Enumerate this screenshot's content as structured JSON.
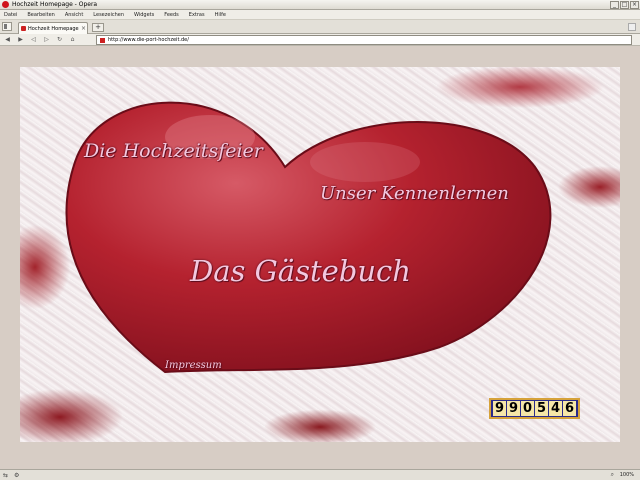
{
  "window": {
    "title": "Hochzeit Homepage - Opera"
  },
  "menu": [
    "Datei",
    "Bearbeiten",
    "Ansicht",
    "Lesezeichen",
    "Widgets",
    "Feeds",
    "Extras",
    "Hilfe"
  ],
  "tab": {
    "label": "Hochzeit Homepage",
    "close": "×"
  },
  "newtab": "+",
  "nav": {
    "back": "◀",
    "forward": "▶",
    "rewind": "◁",
    "fastforward": "▷",
    "reload": "↻",
    "home": "⌂"
  },
  "address": {
    "url": "http://www.die-port-hochzeit.de/"
  },
  "page": {
    "links": {
      "hochzeitsfeier": "Die Hochzeitsfeier",
      "kennenlernen": "Unser Kennenlernen",
      "gaestebuch": "Das Gästebuch",
      "impressum": "Impressum"
    },
    "counter": {
      "value": "990546",
      "digits": [
        "9",
        "9",
        "0",
        "5",
        "4",
        "6"
      ]
    }
  },
  "status": {
    "zoom": "100%"
  },
  "colors": {
    "heart": "#a3162a",
    "link_text": "#f3c8df",
    "background": "#d7cdc5"
  }
}
